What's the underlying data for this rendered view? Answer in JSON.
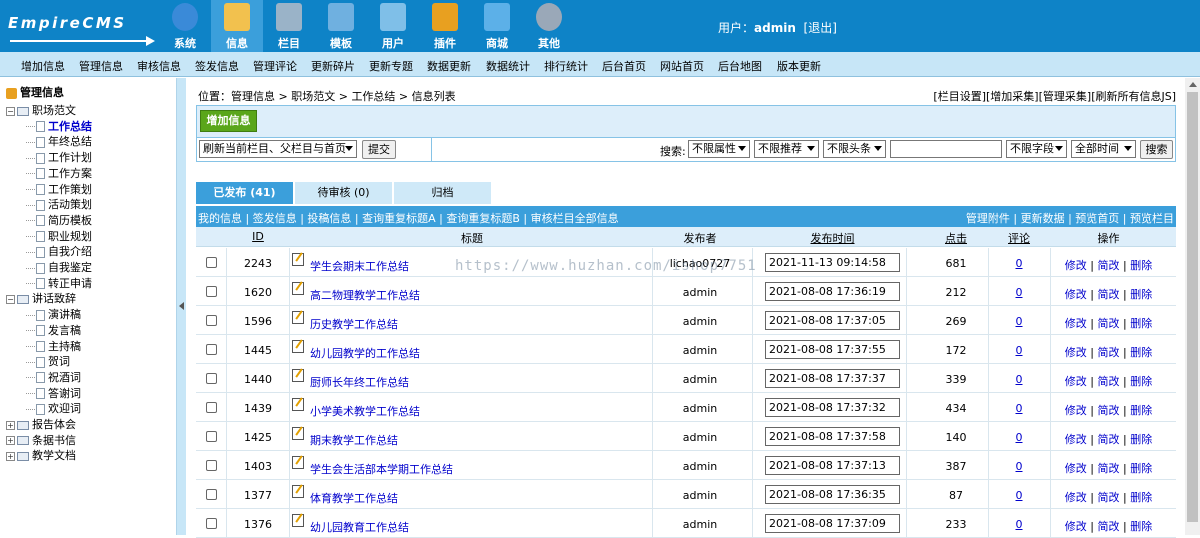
{
  "logo": {
    "text": "EmpireCMS"
  },
  "topnav": [
    {
      "label": "系统",
      "icon": "globe-icon"
    },
    {
      "label": "信息",
      "icon": "document-edit-icon"
    },
    {
      "label": "栏目",
      "icon": "folder-icon"
    },
    {
      "label": "模板",
      "icon": "template-icon"
    },
    {
      "label": "用户",
      "icon": "user-icon"
    },
    {
      "label": "插件",
      "icon": "tools-icon"
    },
    {
      "label": "商城",
      "icon": "shop-card-icon"
    },
    {
      "label": "其他",
      "icon": "gear-icon"
    }
  ],
  "user": {
    "prefix": "用户：",
    "name": "admin",
    "logout": "[退出]"
  },
  "menu2": [
    "增加信息",
    "管理信息",
    "审核信息",
    "签发信息",
    "管理评论",
    "更新碎片",
    "更新专题",
    "数据更新",
    "数据统计",
    "排行统计",
    "后台首页",
    "网站首页",
    "后台地图",
    "版本更新"
  ],
  "sidebar": {
    "title": "管理信息",
    "tree": [
      {
        "label": "职场范文",
        "type": "folder",
        "open": true
      },
      {
        "label": "工作总结",
        "type": "doc",
        "selected": true
      },
      {
        "label": "年终总结",
        "type": "doc"
      },
      {
        "label": "工作计划",
        "type": "doc"
      },
      {
        "label": "工作方案",
        "type": "doc"
      },
      {
        "label": "工作策划",
        "type": "doc"
      },
      {
        "label": "活动策划",
        "type": "doc"
      },
      {
        "label": "简历模板",
        "type": "doc"
      },
      {
        "label": "职业规划",
        "type": "doc"
      },
      {
        "label": "自我介绍",
        "type": "doc"
      },
      {
        "label": "自我鉴定",
        "type": "doc"
      },
      {
        "label": "转正申请",
        "type": "doc"
      },
      {
        "label": "讲话致辞",
        "type": "folder",
        "open": true
      },
      {
        "label": "演讲稿",
        "type": "doc"
      },
      {
        "label": "发言稿",
        "type": "doc"
      },
      {
        "label": "主持稿",
        "type": "doc"
      },
      {
        "label": "贺词",
        "type": "doc"
      },
      {
        "label": "祝酒词",
        "type": "doc"
      },
      {
        "label": "答谢词",
        "type": "doc"
      },
      {
        "label": "欢迎词",
        "type": "doc"
      },
      {
        "label": "报告体会",
        "type": "folder",
        "open": false
      },
      {
        "label": "条据书信",
        "type": "folder",
        "open": false
      },
      {
        "label": "教学文档",
        "type": "folder",
        "open": false
      }
    ]
  },
  "crumb": {
    "prefix": "位置：",
    "items": [
      "管理信息",
      "职场范文",
      "工作总结",
      "信息列表"
    ],
    "sep": " > "
  },
  "rlinks": [
    "[栏目设置]",
    "[增加采集]",
    "[管理采集]",
    "[刷新所有信息JS]"
  ],
  "toolbar": {
    "add": "增加信息",
    "refresh_select": "刷新当前栏目、父栏目与首页",
    "submit": "提交",
    "search_label": "搜索:",
    "attr": "不限属性",
    "recommend": "不限推荐",
    "headline": "不限头条",
    "field": "不限字段",
    "time": "全部时间",
    "search_btn": "搜索"
  },
  "tabs": [
    "已发布 (41)",
    "待审核 (0)",
    "归档"
  ],
  "linkbar": {
    "left": [
      "我的信息",
      "签发信息",
      "投稿信息",
      "查询重复标题A",
      "查询重复标题B",
      "审核栏目全部信息"
    ],
    "right": [
      "管理附件",
      "更新数据",
      "预览首页",
      "预览栏目"
    ]
  },
  "columns": {
    "id": "ID",
    "title": "标题",
    "publisher": "发布者",
    "time": "发布时间",
    "clicks": "点击",
    "comments": "评论",
    "ops": "操作"
  },
  "ops": {
    "edit": "修改",
    "quick_edit": "简改",
    "delete": "删除"
  },
  "rows": [
    {
      "id": "2243",
      "title": "学生会期末工作总结",
      "publisher": "lichao0727",
      "time": "2021-11-13 09:14:58",
      "clicks": "681",
      "comments": "0"
    },
    {
      "id": "1620",
      "title": "高二物理教学工作总结",
      "publisher": "admin",
      "time": "2021-08-08 17:36:19",
      "clicks": "212",
      "comments": "0"
    },
    {
      "id": "1596",
      "title": "历史教学工作总结",
      "publisher": "admin",
      "time": "2021-08-08 17:37:05",
      "clicks": "269",
      "comments": "0"
    },
    {
      "id": "1445",
      "title": "幼儿园教学的工作总结",
      "publisher": "admin",
      "time": "2021-08-08 17:37:55",
      "clicks": "172",
      "comments": "0"
    },
    {
      "id": "1440",
      "title": "厨师长年终工作总结",
      "publisher": "admin",
      "time": "2021-08-08 17:37:37",
      "clicks": "339",
      "comments": "0"
    },
    {
      "id": "1439",
      "title": "小学美术教学工作总结",
      "publisher": "admin",
      "time": "2021-08-08 17:37:32",
      "clicks": "434",
      "comments": "0"
    },
    {
      "id": "1425",
      "title": "期末教学工作总结",
      "publisher": "admin",
      "time": "2021-08-08 17:37:58",
      "clicks": "140",
      "comments": "0"
    },
    {
      "id": "1403",
      "title": "学生会生活部本学期工作总结",
      "publisher": "admin",
      "time": "2021-08-08 17:37:13",
      "clicks": "387",
      "comments": "0"
    },
    {
      "id": "1377",
      "title": "体育教学工作总结",
      "publisher": "admin",
      "time": "2021-08-08 17:36:35",
      "clicks": "87",
      "comments": "0"
    },
    {
      "id": "1376",
      "title": "幼儿园教育工作总结",
      "publisher": "admin",
      "time": "2021-08-08 17:37:09",
      "clicks": "233",
      "comments": "0"
    }
  ],
  "watermark": "https://www.huzhan.com/ishop7751"
}
